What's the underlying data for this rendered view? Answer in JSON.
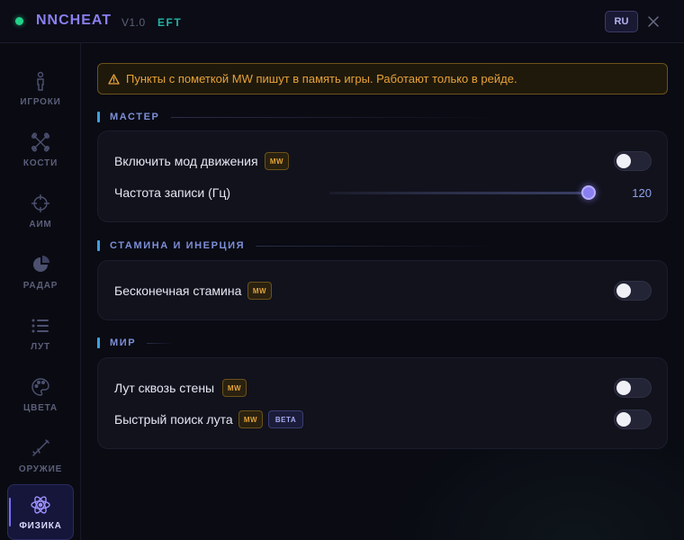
{
  "header": {
    "title": "NNCHEAT",
    "version": "V1.0",
    "game": "EFT",
    "language": "RU"
  },
  "sidebar": {
    "items": [
      {
        "label": "ИГРОКИ",
        "icon": "player-icon"
      },
      {
        "label": "КОСТИ",
        "icon": "bones-icon"
      },
      {
        "label": "АИМ",
        "icon": "crosshair-icon"
      },
      {
        "label": "РАДАР",
        "icon": "radar-icon"
      },
      {
        "label": "ЛУТ",
        "icon": "list-icon"
      },
      {
        "label": "ЦВЕТА",
        "icon": "palette-icon"
      },
      {
        "label": "ОРУЖИЕ",
        "icon": "rifle-icon"
      },
      {
        "label": "ФИЗИКА",
        "icon": "atom-icon",
        "active": true
      }
    ]
  },
  "warning": {
    "text": "Пункты с пометкой MW пишут в память игры. Работают только в рейде."
  },
  "sections": {
    "master": {
      "title": "МАСТЕР",
      "movement_mod": {
        "label": "Включить мод движения",
        "badge": "MW",
        "enabled": false
      },
      "write_rate": {
        "label": "Частота записи (Гц)",
        "value": "120",
        "fraction": 1.0
      }
    },
    "stamina": {
      "title": "СТАМИНА И ИНЕРЦИЯ",
      "infinite_stamina": {
        "label": "Бесконечная стамина",
        "badge": "MW",
        "enabled": false
      }
    },
    "world": {
      "title": "МИР",
      "loot_through_walls": {
        "label": "Лут сквозь стены",
        "badge": "MW",
        "enabled": false
      },
      "fast_loot_search": {
        "label": "Быстрый поиск лута",
        "badge": "MW",
        "badge2": "BETA",
        "enabled": false
      }
    }
  },
  "colors": {
    "accent": "#8a7ff0",
    "online": "#22d38a",
    "warning": "#e8a23a",
    "section_bar": "#3ea0e0"
  }
}
